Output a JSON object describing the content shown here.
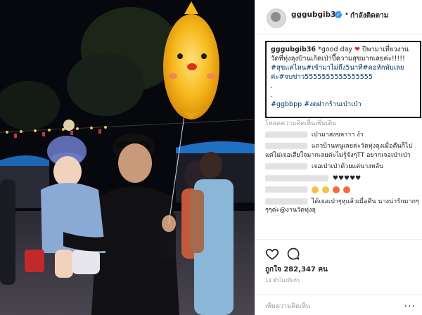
{
  "post": {
    "username": "gggubgib36",
    "follow_label": "กำลังติดตาม",
    "caption_user": "gggubgib36",
    "caption_line1": "*good day",
    "caption_line1b": "ปีพามาเที่ยวงานวัดที่ทุ่งลุงบ้านเกิดเป่าปี๊ความสุขมากเลยค่ะ!!!!!",
    "caption_tags1": "#สุขแค่ไหน#เข้ามาไม่ถึง5นาที#คอหักพับเลยค่ะ#จบข่าว5555555555555555",
    "caption_dot1": ".",
    "caption_dot2": ".",
    "caption_tags2": "#ggbbpp #งดฝากร้านเป่าเป่า"
  },
  "comments": {
    "load_more": "โหลดความคิดเห็นเพิ่มเติม",
    "items": [
      {
        "text": "เป่ามาสงขลาาา งำ"
      },
      {
        "text": "แถวบ้านหนูเลยค่ะวัดทุ่งลุงเมื่อคืนก็ไปแต่ไม่เจอเสียใจมากเลยค่ะไม่รู้จังๆTT อยากเจอเป่าเป่า"
      },
      {
        "text": "เจอเป่าเป่าด้วยแต่นางหลับ"
      },
      {
        "text": "♥♥♥♥♥"
      },
      {
        "text": ""
      },
      {
        "text": "ได้เจอเป่าๆหุแล้วเมื่อคืน นางน่ารักมากๆๆๆค่ะ@งานวัดทุ่งลุ"
      }
    ]
  },
  "actions": {
    "likes": "ถูกใจ 282,347 คน",
    "timestamp": "18 ชั่วโมงที่แล้ว",
    "add_comment_placeholder": "เพิ่มความคิดเห็น",
    "more": "..."
  },
  "colors": {
    "verified": "#3897f0",
    "heart": "#ed1c24",
    "balloon": "#f6b81c",
    "night_sky": "#07080e"
  }
}
